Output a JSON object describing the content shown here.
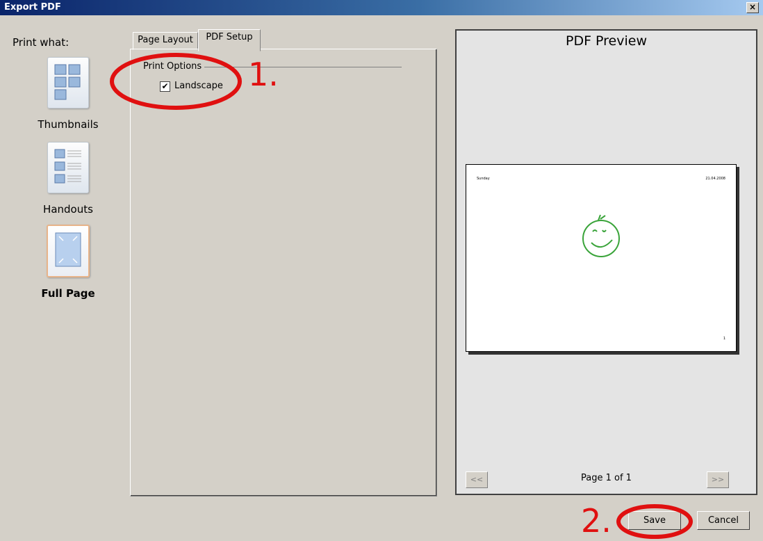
{
  "window": {
    "title": "Export PDF",
    "close_glyph": "×"
  },
  "sidebar": {
    "heading": "Print what:",
    "items": [
      {
        "label": "Thumbnails",
        "icon": "thumbnails-icon",
        "selected": false
      },
      {
        "label": "Handouts",
        "icon": "handouts-icon",
        "selected": false
      },
      {
        "label": "Full Page",
        "icon": "full-page-icon",
        "selected": true
      }
    ]
  },
  "tabs": [
    {
      "label": "Page Layout",
      "active": false
    },
    {
      "label": "PDF Setup",
      "active": true
    }
  ],
  "print_options": {
    "group_title": "Print Options",
    "landscape_label": "Landscape",
    "landscape_checked": true,
    "check_glyph": "✔"
  },
  "preview": {
    "title": "PDF Preview",
    "page_header_left": "Sunday",
    "page_header_right": "21.04.2008",
    "page_number": "1",
    "page_indicator": "Page 1 of 1",
    "prev_label": "<<",
    "next_label": ">>"
  },
  "buttons": {
    "save": "Save",
    "cancel": "Cancel"
  },
  "annotations": {
    "step1": "1.",
    "step2": "2.",
    "color": "#e01010"
  }
}
